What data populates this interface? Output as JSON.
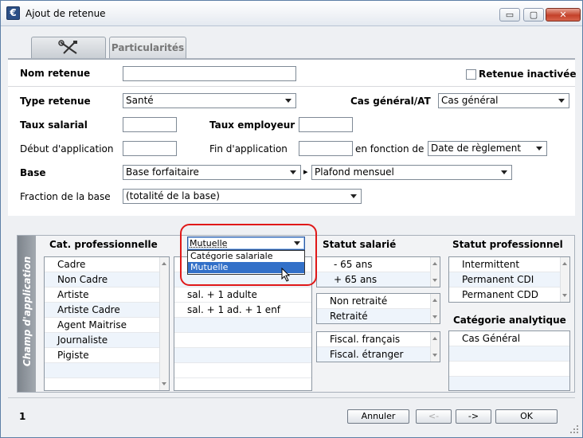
{
  "window": {
    "title": "Ajout de retenue",
    "minimize": "▭",
    "restore": "▢",
    "close": "✕",
    "app_icon": "€"
  },
  "tabs": [
    {
      "icon": "tools-icon"
    },
    {
      "label": "Particularités"
    }
  ],
  "form": {
    "nom_label": "Nom retenue",
    "nom_value": "",
    "inactive_label": "Retenue inactivée",
    "type_label": "Type retenue",
    "type_value": "Santé",
    "cas_label": "Cas général/AT",
    "cas_value": "Cas général",
    "taux_sal_label": "Taux salarial",
    "taux_emp_label": "Taux employeur",
    "debut_label": "Début d'application",
    "fin_label": "Fin d'application",
    "fonction_label": "en fonction de",
    "fonction_value": "Date de règlement",
    "base_label": "Base",
    "base_value": "Base forfaitaire",
    "base_sep": "▸",
    "plafond_value": "Plafond mensuel",
    "fraction_label": "Fraction de la base",
    "fraction_value": "(totalité de la base)"
  },
  "champ": {
    "vertical_label": "Champ d'application",
    "cat_header": "Cat. professionnelle",
    "categories": [
      "Cadre",
      "Non Cadre",
      "Artiste",
      "Artiste Cadre",
      "Agent Maitrise",
      "Journaliste",
      "Pigiste"
    ],
    "dropdown_value": "Mutuelle",
    "dropdown_options": [
      "Catégorie salariale",
      "Mutuelle"
    ],
    "mutuelle_items": [
      "sal. + 1 adulte",
      "sal. + 1 ad. + 1 enf"
    ],
    "statut_sal_header": "Statut salarié",
    "ages": [
      "- 65 ans",
      "+ 65 ans"
    ],
    "retraite": [
      "Non retraité",
      "Retraité"
    ],
    "fiscal": [
      "Fiscal. français",
      "Fiscal. étranger"
    ],
    "statut_pro_header": "Statut professionnel",
    "statut_pro": [
      "Intermittent",
      "Permanent CDI",
      "Permanent CDD"
    ],
    "analytique_header": "Catégorie analytique",
    "analytique": [
      "Cas Général"
    ]
  },
  "footer": {
    "page": "1",
    "annuler": "Annuler",
    "prev": "<-",
    "next": "->",
    "ok": "OK"
  },
  "colors": {
    "selection": "#3270c8",
    "highlight": "#e01818",
    "side_tab": "#7d848c"
  }
}
